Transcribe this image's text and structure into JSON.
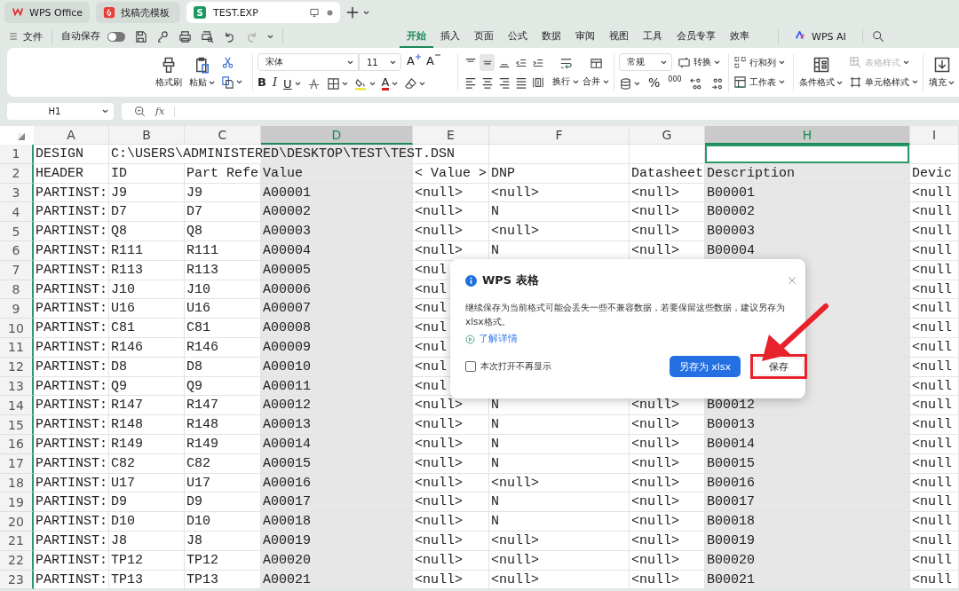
{
  "tabs": [
    {
      "label": "WPS Office",
      "selected": false,
      "kind": "home"
    },
    {
      "label": "找稿壳模板",
      "selected": false,
      "kind": "template"
    },
    {
      "label": "TEST.EXP",
      "selected": true,
      "kind": "sheet",
      "logo_letter": "S"
    }
  ],
  "menu": {
    "file": "文件",
    "autosave": {
      "label": "自动保存",
      "on": false
    },
    "redo_disabled": true,
    "tabs": [
      {
        "label": "开始",
        "selected": true
      },
      {
        "label": "插入",
        "selected": false
      },
      {
        "label": "页面",
        "selected": false
      },
      {
        "label": "公式",
        "selected": false
      },
      {
        "label": "数据",
        "selected": false
      },
      {
        "label": "审阅",
        "selected": false
      },
      {
        "label": "视图",
        "selected": false
      },
      {
        "label": "工具",
        "selected": false
      },
      {
        "label": "会员专享",
        "selected": false
      },
      {
        "label": "效率",
        "selected": false
      }
    ],
    "ai": "WPS AI"
  },
  "ribbon": {
    "format_painter": "格式刷",
    "paste": "粘贴",
    "font_name": "宋体",
    "font_size": "11",
    "grow_font": "A",
    "shrink_font": "A",
    "style_buttons": [
      "B",
      "I",
      "U"
    ],
    "font_color": "A",
    "align_buttons": [
      {
        "selected": false
      },
      {
        "selected": true
      },
      {
        "selected": false
      },
      {
        "selected": false
      },
      {
        "selected": false
      },
      {
        "selected": false
      },
      {
        "selected": false
      },
      {
        "selected": false
      },
      {
        "selected": false
      },
      {
        "selected": false
      }
    ],
    "wrap": "换行",
    "merge": "合并",
    "number_format": "常规",
    "convert": "转换",
    "percent": "%",
    "thousands": "000",
    "rows_columns": "行和列",
    "worksheet": "工作表",
    "conditional_format": "条件格式",
    "table_style": {
      "label": "表格样式",
      "disabled": true
    },
    "cell_style": "单元格样式",
    "fill": "填充"
  },
  "formula_bar": {
    "name_box": "H1",
    "fx": "fx"
  },
  "sheet": {
    "columns": [
      {
        "label": "A",
        "selected": false
      },
      {
        "label": "B",
        "selected": false
      },
      {
        "label": "C",
        "selected": false
      },
      {
        "label": "D",
        "selected": true
      },
      {
        "label": "E",
        "selected": false
      },
      {
        "label": "F",
        "selected": false
      },
      {
        "label": "G",
        "selected": false
      },
      {
        "label": "H",
        "selected": true
      },
      {
        "label": "I",
        "selected": false
      }
    ],
    "rows": [
      {
        "header": "1",
        "cells": [
          "DESIGN",
          "C:\\USERS\\ADMINISTERED\\DESKTOP\\TEST\\TEST.DSN",
          null,
          null,
          null,
          null,
          null,
          {
            "active": true
          },
          null
        ]
      },
      {
        "header": "2",
        "cells": [
          "HEADER",
          "ID",
          "Part Refe",
          "Value",
          "< Value >",
          "DNP",
          "Datasheet",
          "Description",
          "Devic"
        ]
      },
      {
        "header": "3",
        "cells": [
          "PARTINST:",
          "J9",
          "J9",
          "A00001",
          "<null>",
          "<null>",
          "<null>",
          "B00001",
          "<null"
        ]
      },
      {
        "header": "4",
        "cells": [
          "PARTINST:",
          "D7",
          "D7",
          "A00002",
          "<null>",
          "N",
          "<null>",
          "B00002",
          "<null"
        ]
      },
      {
        "header": "5",
        "cells": [
          "PARTINST:",
          "Q8",
          "Q8",
          "A00003",
          "<null>",
          "<null>",
          "<null>",
          "B00003",
          "<null"
        ]
      },
      {
        "header": "6",
        "cells": [
          "PARTINST:",
          "R111",
          "R111",
          "A00004",
          "<null>",
          "N",
          "<null>",
          "B00004",
          "<null"
        ]
      },
      {
        "header": "7",
        "cells": [
          "PARTINST:",
          "R113",
          "R113",
          "A00005",
          "<nul",
          null,
          null,
          null,
          "<null"
        ]
      },
      {
        "header": "8",
        "cells": [
          "PARTINST:",
          "J10",
          "J10",
          "A00006",
          "<nul",
          null,
          null,
          null,
          "<null"
        ]
      },
      {
        "header": "9",
        "cells": [
          "PARTINST:",
          "U16",
          "U16",
          "A00007",
          "<nul",
          null,
          null,
          null,
          "<null"
        ]
      },
      {
        "header": "10",
        "cells": [
          "PARTINST:",
          "C81",
          "C81",
          "A00008",
          "<nul",
          null,
          null,
          null,
          "<null"
        ]
      },
      {
        "header": "11",
        "cells": [
          "PARTINST:",
          "R146",
          "R146",
          "A00009",
          "<nul",
          null,
          null,
          null,
          "<null"
        ]
      },
      {
        "header": "12",
        "cells": [
          "PARTINST:",
          "D8",
          "D8",
          "A00010",
          "<nul",
          null,
          null,
          null,
          "<null"
        ]
      },
      {
        "header": "13",
        "cells": [
          "PARTINST:",
          "Q9",
          "Q9",
          "A00011",
          "<nul",
          null,
          null,
          null,
          "<null"
        ]
      },
      {
        "header": "14",
        "cells": [
          "PARTINST:",
          "R147",
          "R147",
          "A00012",
          "<null>",
          "N",
          "<null>",
          "B00012",
          "<null"
        ]
      },
      {
        "header": "15",
        "cells": [
          "PARTINST:",
          "R148",
          "R148",
          "A00013",
          "<null>",
          "N",
          "<null>",
          "B00013",
          "<null"
        ]
      },
      {
        "header": "16",
        "cells": [
          "PARTINST:",
          "R149",
          "R149",
          "A00014",
          "<null>",
          "N",
          "<null>",
          "B00014",
          "<null"
        ]
      },
      {
        "header": "17",
        "cells": [
          "PARTINST:",
          "C82",
          "C82",
          "A00015",
          "<null>",
          "N",
          "<null>",
          "B00015",
          "<null"
        ]
      },
      {
        "header": "18",
        "cells": [
          "PARTINST:",
          "U17",
          "U17",
          "A00016",
          "<null>",
          "<null>",
          "<null>",
          "B00016",
          "<null"
        ]
      },
      {
        "header": "19",
        "cells": [
          "PARTINST:",
          "D9",
          "D9",
          "A00017",
          "<null>",
          "N",
          "<null>",
          "B00017",
          "<null"
        ]
      },
      {
        "header": "20",
        "cells": [
          "PARTINST:",
          "D10",
          "D10",
          "A00018",
          "<null>",
          "N",
          "<null>",
          "B00018",
          "<null"
        ]
      },
      {
        "header": "21",
        "cells": [
          "PARTINST:",
          "J8",
          "J8",
          "A00019",
          "<null>",
          "<null>",
          "<null>",
          "B00019",
          "<null"
        ]
      },
      {
        "header": "22",
        "cells": [
          "PARTINST:",
          "TP12",
          "TP12",
          "A00020",
          "<null>",
          "<null>",
          "<null>",
          "B00020",
          "<null"
        ]
      },
      {
        "header": "23",
        "cells": [
          "PARTINST:",
          "TP13",
          "TP13",
          "A00021",
          "<null>",
          "<null>",
          "<null>",
          "B00021",
          "<null"
        ]
      }
    ]
  },
  "dialog": {
    "title": "WPS 表格",
    "message": "继续保存为当前格式可能会丢失一些不兼容数据，若要保留这些数据，建议另存为xlsx格式。",
    "link": "了解详情",
    "checkbox": {
      "label": "本次打开不再显示",
      "checked": false
    },
    "buttons": [
      {
        "label": "另存为 xlsx",
        "kind": "primary",
        "highlighted": false
      },
      {
        "label": "保存",
        "kind": "secondary",
        "highlighted": true
      }
    ]
  }
}
